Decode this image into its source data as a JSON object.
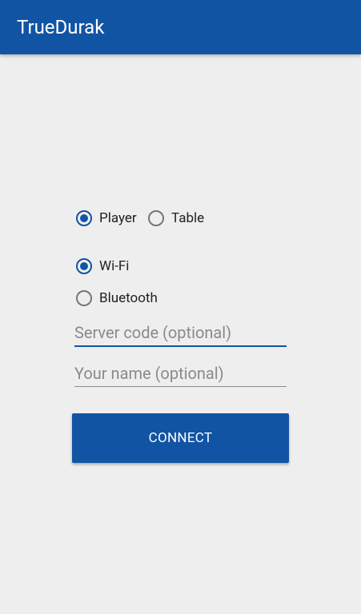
{
  "app": {
    "title": "TrueDurak"
  },
  "mode": {
    "options": [
      {
        "label": "Player",
        "checked": true
      },
      {
        "label": "Table",
        "checked": false
      }
    ]
  },
  "transport": {
    "options": [
      {
        "label": "Wi-Fi",
        "checked": true
      },
      {
        "label": "Bluetooth",
        "checked": false
      }
    ]
  },
  "form": {
    "server_code": {
      "value": "",
      "placeholder": "Server code (optional)"
    },
    "name": {
      "value": "",
      "placeholder": "Your name (optional)"
    }
  },
  "connect_button": {
    "label": "CONNECT"
  },
  "colors": {
    "primary": "#1254a4",
    "background": "#eeeeee"
  }
}
